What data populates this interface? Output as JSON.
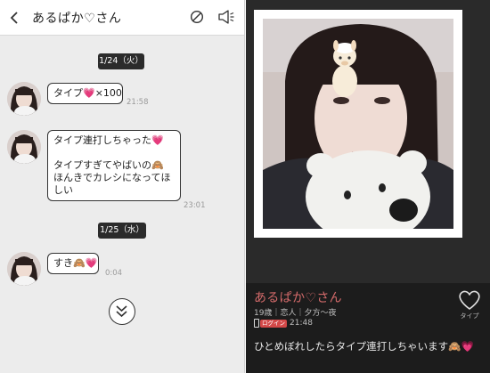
{
  "chat": {
    "header": {
      "back_icon": "chevron-left-icon",
      "title": "あるぱか♡さん",
      "block_icon": "block-icon",
      "report_icon": "megaphone-icon"
    },
    "dates": [
      "1/24（火）",
      "1/25（水）"
    ],
    "messages": [
      {
        "lines": [
          "タイプ💗×100"
        ],
        "time": "21:58"
      },
      {
        "lines": [
          "タイプ連打しちゃった💗",
          "",
          "タイプすぎてやばいの🙈",
          "ほんきでカレシになってほ",
          "しい"
        ],
        "time": "23:01"
      },
      {
        "lines": [
          "すき🙈💗"
        ],
        "time": "0:04"
      }
    ],
    "scroll_icon": "double-chevron-down-icon"
  },
  "profile": {
    "name": "あるぱか♡さん",
    "meta": "19歳｜恋人｜夕方〜夜",
    "login_badge": "ログイン",
    "login_time": "21:48",
    "like_icon": "heart-icon",
    "like_label": "タイプ",
    "comment": "ひとめぼれしたらタイプ連打しちゃいます🙈💗",
    "colors": {
      "name": "#d36a6a",
      "login_badge": "#d34848"
    }
  }
}
